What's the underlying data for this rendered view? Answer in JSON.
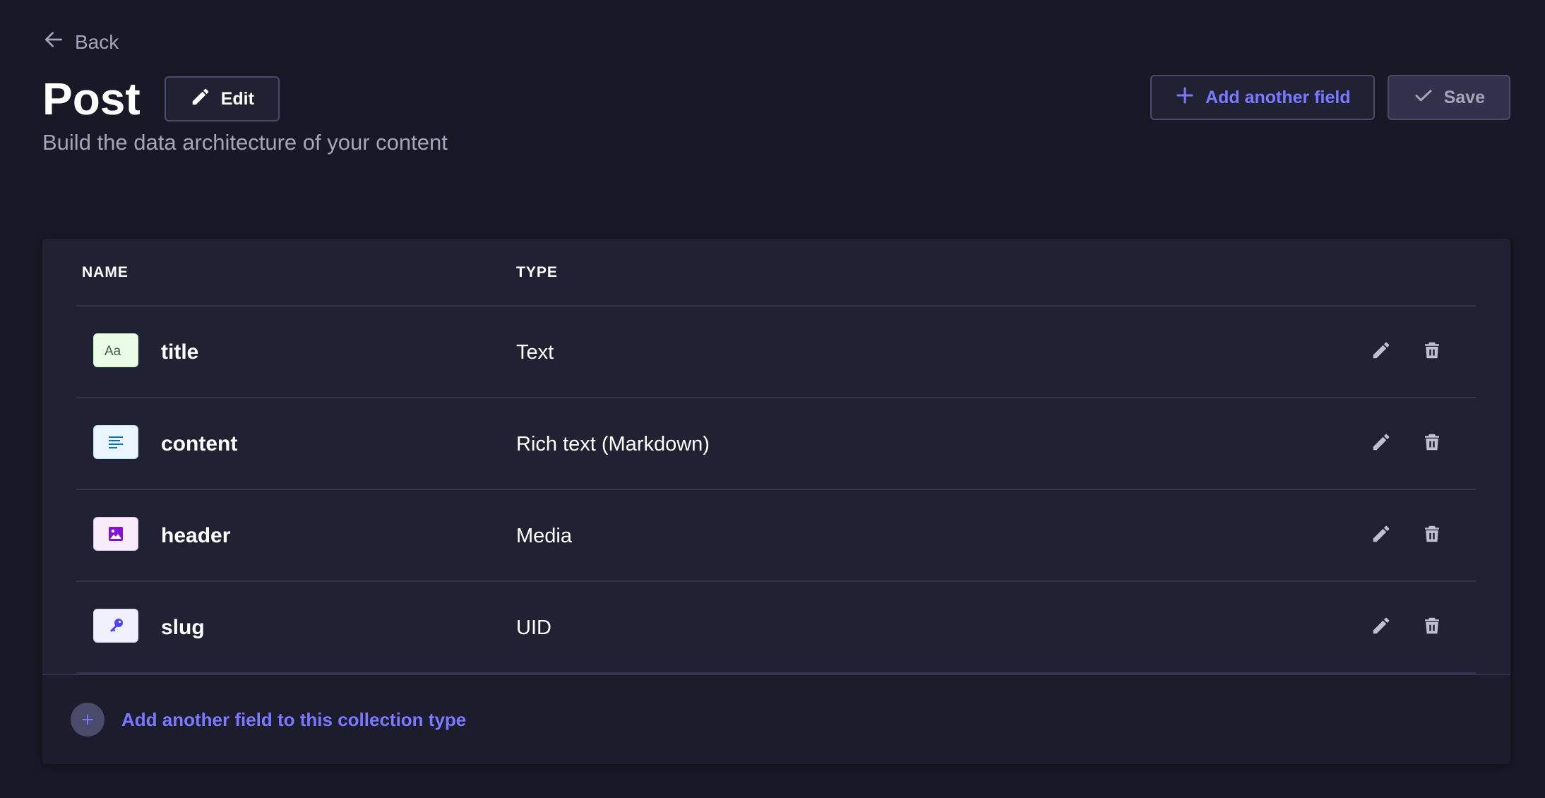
{
  "nav": {
    "back_label": "Back"
  },
  "header": {
    "title": "Post",
    "edit_label": "Edit",
    "subtitle": "Build the data architecture of your content",
    "add_field_label": "Add another field",
    "save_label": "Save"
  },
  "table": {
    "columns": [
      "NAME",
      "TYPE"
    ],
    "rows": [
      {
        "name": "title",
        "type": "Text",
        "icon": "text-field-icon"
      },
      {
        "name": "content",
        "type": "Rich text (Markdown)",
        "icon": "richtext-field-icon"
      },
      {
        "name": "header",
        "type": "Media",
        "icon": "media-field-icon"
      },
      {
        "name": "slug",
        "type": "UID",
        "icon": "uid-field-icon"
      }
    ]
  },
  "footer": {
    "add_field_label": "Add another field to this collection type"
  },
  "colors": {
    "background": "#181826",
    "card": "#212134",
    "accent": "#7b79ff",
    "muted": "#a5a5ba"
  }
}
